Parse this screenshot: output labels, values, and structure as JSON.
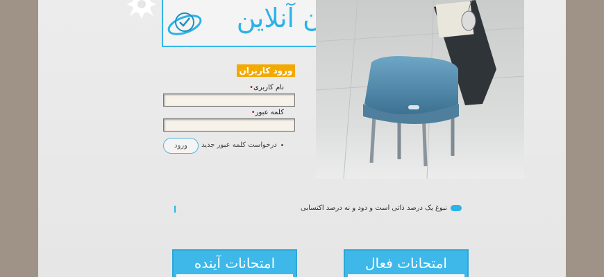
{
  "header": {
    "logo_text": "آزمون آنلاین"
  },
  "login": {
    "title": "ورود کاربران",
    "username_label": "نام کاربری",
    "username_value": "",
    "password_label": "کلمه عبور",
    "password_value": "",
    "submit_label": "ورود",
    "forgot_link": "درخواست کلمه عبور جدید"
  },
  "news": {
    "quote": "نبوغ یک درصد ذاتی است و دود و نه درصد اکتسابی"
  },
  "tabs": [
    {
      "label": "امتحانات آینده"
    },
    {
      "label": "امتحانات فعال"
    }
  ],
  "colors": {
    "accent": "#2bb3e8",
    "login_title_bg": "#f2a900",
    "background": "#9e9386"
  }
}
